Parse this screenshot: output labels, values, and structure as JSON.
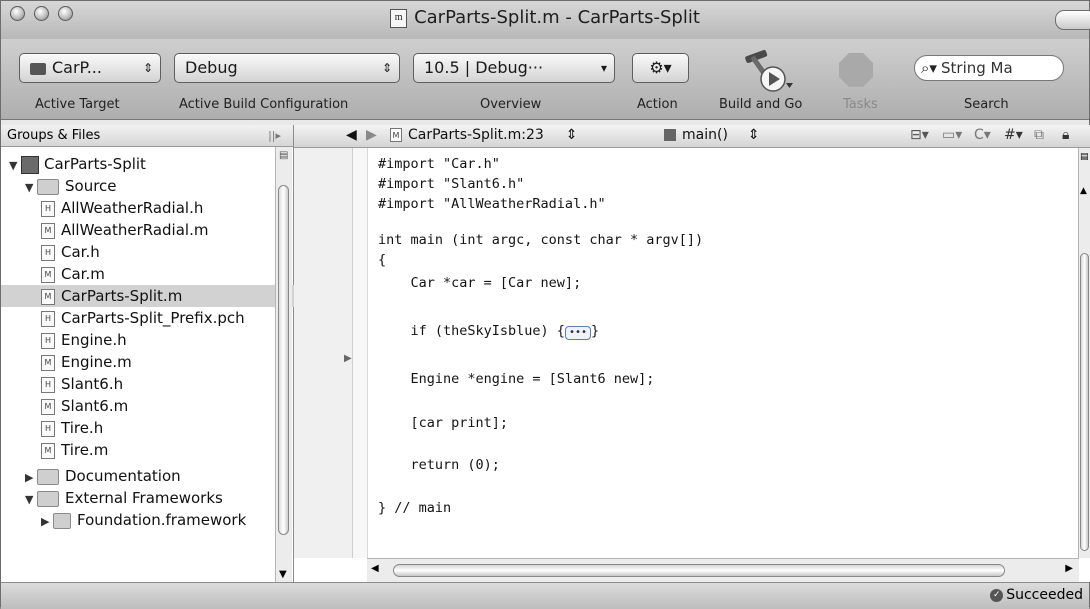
{
  "window": {
    "title": "CarParts-Split.m - CarParts-Split"
  },
  "toolbar": {
    "target_popup": "CarP...",
    "config_popup": "Debug",
    "overview_popup": "10.5 | Debug···",
    "search_value": "String Ma",
    "labels": {
      "active_target": "Active Target",
      "active_build_configuration": "Active Build Configuration",
      "overview": "Overview",
      "action": "Action",
      "build_and_go": "Build and Go",
      "tasks": "Tasks",
      "search": "Search"
    }
  },
  "sidebar": {
    "header": "Groups & Files",
    "items": [
      {
        "label": "CarParts-Split"
      },
      {
        "label": "Source"
      },
      {
        "label": "AllWeatherRadial.h"
      },
      {
        "label": "AllWeatherRadial.m"
      },
      {
        "label": "Car.h"
      },
      {
        "label": "Car.m"
      },
      {
        "label": "CarParts-Split.m"
      },
      {
        "label": "CarParts-Split_Prefix.pch"
      },
      {
        "label": "Engine.h"
      },
      {
        "label": "Engine.m"
      },
      {
        "label": "Slant6.h"
      },
      {
        "label": "Slant6.m"
      },
      {
        "label": "Tire.h"
      },
      {
        "label": "Tire.m"
      },
      {
        "label": "Documentation"
      },
      {
        "label": "External Frameworks"
      },
      {
        "label": "Foundation.framework"
      }
    ]
  },
  "editor": {
    "file_popup": "CarParts-Split.m:23",
    "func_popup": "main()",
    "code": [
      "#import \"Car.h\"",
      "#import \"Slant6.h\"",
      "#import \"AllWeatherRadial.h\"",
      "int main (int argc, const char * argv[])",
      "{",
      "    Car *car = [Car new];",
      "    if (theSkyIsblue) {",
      "}",
      "    Engine *engine = [Slant6 new];",
      "    [car print];",
      "    return (0);",
      "} // main"
    ]
  },
  "status": {
    "text": "Succeeded"
  },
  "colors": {
    "selection": "#d2d2d2",
    "toolbar": "#bfbfbf",
    "fold_border": "#5a7fb5"
  }
}
